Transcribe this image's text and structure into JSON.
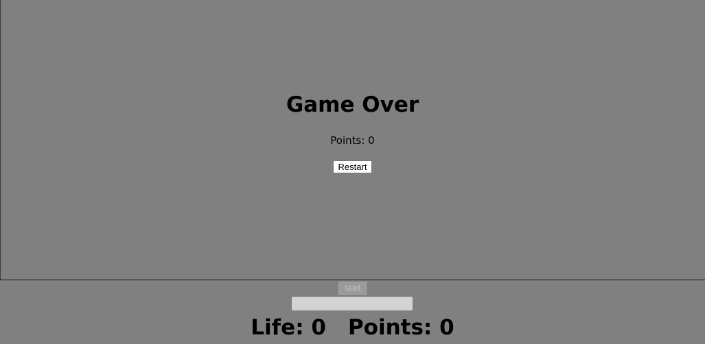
{
  "game_over": {
    "title": "Game Over",
    "points_label": "Points: 0",
    "restart_label": "Restart"
  },
  "controls": {
    "start_label": "start"
  },
  "hud": {
    "life_label": "Life: 0",
    "points_label": "Points: 0"
  }
}
